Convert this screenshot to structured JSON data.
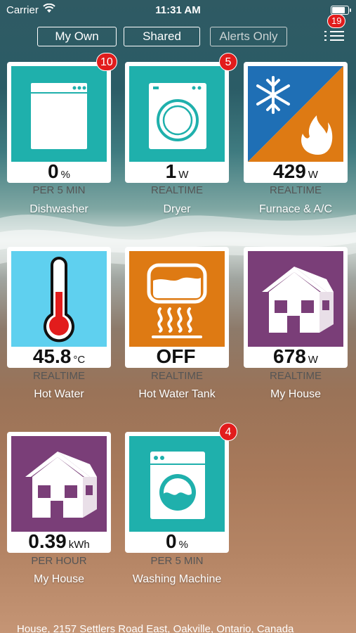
{
  "status_bar": {
    "carrier": "Carrier",
    "time": "11:31 AM"
  },
  "filters": {
    "my_own": "My Own",
    "shared": "Shared",
    "alerts_only": "Alerts Only"
  },
  "menu": {
    "badge": "19"
  },
  "colors": {
    "teal": "#1fb0ac",
    "orange": "#de7a13",
    "purple": "#7a3e78",
    "lightblue": "#5fd0ef",
    "blue": "#1f6fb5",
    "badge_red": "#e21c1c"
  },
  "devices": [
    {
      "name": "Dishwasher",
      "value": "0",
      "unit": "%",
      "period": "PER 5 MIN",
      "badge": "10",
      "icon": "dishwasher-icon"
    },
    {
      "name": "Dryer",
      "value": "1",
      "unit": "W",
      "period": "REALTIME",
      "badge": "5",
      "icon": "dryer-icon"
    },
    {
      "name": "Furnace & A/C",
      "value": "429",
      "unit": "W",
      "period": "REALTIME",
      "icon": "furnace-ac-icon"
    },
    {
      "name": "Hot Water",
      "value": "45.8",
      "unit": "°C",
      "period": "REALTIME",
      "icon": "thermometer-icon"
    },
    {
      "name": "Hot Water Tank",
      "value": "OFF",
      "unit": "",
      "period": "REALTIME",
      "icon": "water-tank-icon"
    },
    {
      "name": "My House",
      "value": "678",
      "unit": "W",
      "period": "REALTIME",
      "icon": "house-icon"
    },
    {
      "name": "My House",
      "value": "0.39",
      "unit": "kWh",
      "period": "PER HOUR",
      "icon": "house-icon"
    },
    {
      "name": "Washing Machine",
      "value": "0",
      "unit": "%",
      "period": "PER 5 MIN",
      "badge": "4",
      "icon": "washing-machine-icon"
    }
  ],
  "footer": {
    "address": "House, 2157 Settlers Road East, Oakville, Ontario, Canada"
  }
}
